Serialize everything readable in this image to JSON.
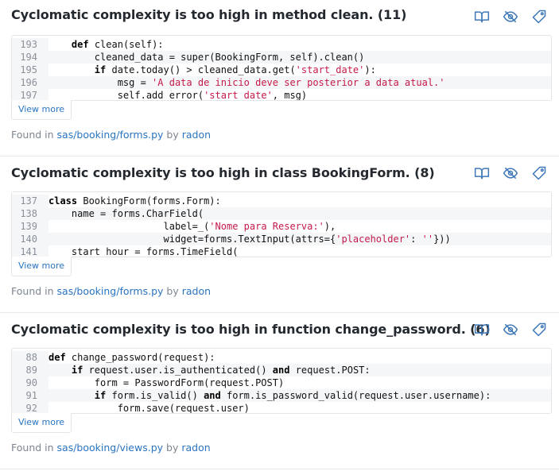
{
  "found_in_label": "Found in",
  "by_label": "by",
  "view_more_label": "View more",
  "issues": [
    {
      "title": "Cyclomatic complexity is too high in method clean. (11)",
      "file": "sas/booking/forms.py",
      "engine": "radon",
      "lines": [
        {
          "n": "193",
          "code": "    def clean(self):"
        },
        {
          "n": "194",
          "code": "        cleaned_data = super(BookingForm, self).clean()"
        },
        {
          "n": "195",
          "code": "        if date.today() > cleaned_data.get('start_date'):"
        },
        {
          "n": "196",
          "code": "            msg = 'A data de inicio deve ser posterior a data atual.'"
        },
        {
          "n": "197",
          "code": "            self.add_error('start_date', msg)"
        }
      ]
    },
    {
      "title": "Cyclomatic complexity is too high in class BookingForm. (8)",
      "file": "sas/booking/forms.py",
      "engine": "radon",
      "lines": [
        {
          "n": "137",
          "code": "class BookingForm(forms.Form):"
        },
        {
          "n": "138",
          "code": "    name = forms.CharField("
        },
        {
          "n": "139",
          "code": "                    label=_('Nome para Reserva:'),"
        },
        {
          "n": "140",
          "code": "                    widget=forms.TextInput(attrs={'placeholder': ''}))"
        },
        {
          "n": "141",
          "code": "    start_hour = forms.TimeField("
        }
      ]
    },
    {
      "title": "Cyclomatic complexity is too high in function change_password. (6)",
      "file": "sas/booking/views.py",
      "engine": "radon",
      "lines": [
        {
          "n": "88",
          "code": "def change_password(request):"
        },
        {
          "n": "89",
          "code": "    if request.user.is_authenticated() and request.POST:"
        },
        {
          "n": "90",
          "code": "        form = PasswordForm(request.POST)"
        },
        {
          "n": "91",
          "code": "        if form.is_valid() and form.is_password_valid(request.user.username):"
        },
        {
          "n": "92",
          "code": "            form.save(request.user)"
        }
      ]
    }
  ],
  "icons": {
    "read_up": "book-open-icon",
    "ignore": "eye-slash-icon",
    "tag": "tag-icon"
  },
  "colors": {
    "link": "#2a74c0",
    "icon": "#2a74c0",
    "string": "#c41a4a"
  }
}
